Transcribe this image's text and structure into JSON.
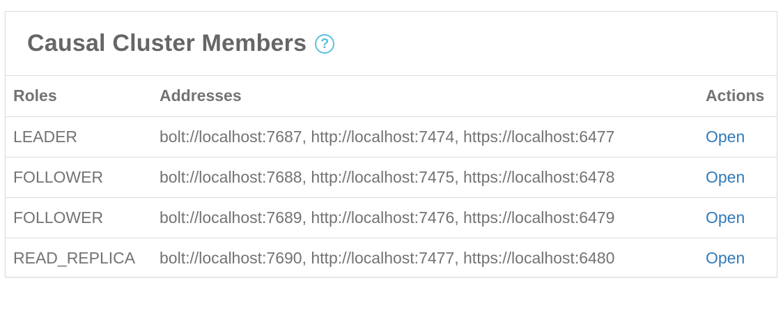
{
  "panel": {
    "title": "Causal Cluster Members",
    "help_icon": "question-circle-icon",
    "accent_color": "#5bc0de",
    "link_color": "#337ab7"
  },
  "table": {
    "columns": {
      "roles": "Roles",
      "addresses": "Addresses",
      "actions": "Actions"
    },
    "rows": [
      {
        "role": "LEADER",
        "addresses": "bolt://localhost:7687, http://localhost:7474, https://localhost:6477",
        "action": "Open"
      },
      {
        "role": "FOLLOWER",
        "addresses": "bolt://localhost:7688, http://localhost:7475, https://localhost:6478",
        "action": "Open"
      },
      {
        "role": "FOLLOWER",
        "addresses": "bolt://localhost:7689, http://localhost:7476, https://localhost:6479",
        "action": "Open"
      },
      {
        "role": "READ_REPLICA",
        "addresses": "bolt://localhost:7690, http://localhost:7477, https://localhost:6480",
        "action": "Open"
      }
    ]
  }
}
